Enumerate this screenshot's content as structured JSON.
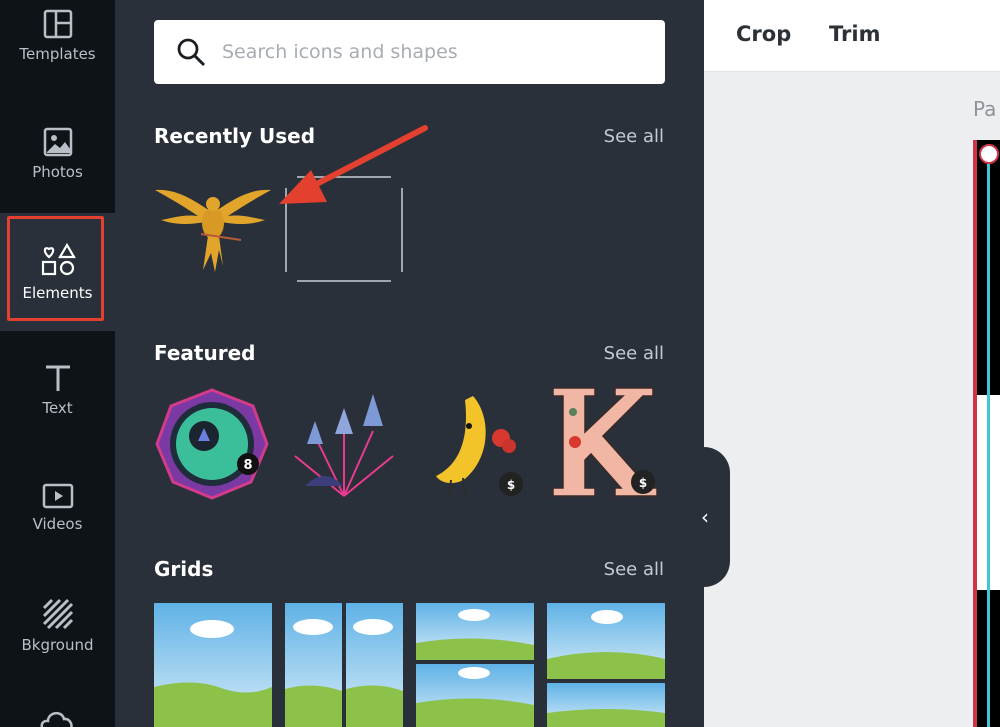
{
  "sidebar": {
    "items": [
      {
        "label": "Templates",
        "icon": "templates-icon"
      },
      {
        "label": "Photos",
        "icon": "photo-icon"
      },
      {
        "label": "Elements",
        "icon": "elements-icon",
        "selected": true
      },
      {
        "label": "Text",
        "icon": "text-icon"
      },
      {
        "label": "Videos",
        "icon": "video-icon"
      },
      {
        "label": "Bkground",
        "icon": "background-icon"
      }
    ]
  },
  "search": {
    "placeholder": "Search icons and shapes"
  },
  "sections": {
    "recent": {
      "title": "Recently Used",
      "see_all": "See all"
    },
    "featured": {
      "title": "Featured",
      "see_all": "See all",
      "price_badge": "$"
    },
    "grids": {
      "title": "Grids",
      "see_all": "See all"
    }
  },
  "toolbar": {
    "crop": "Crop",
    "trim": "Trim"
  },
  "canvas": {
    "page_label": "Pa"
  },
  "collapse_glyph": "‹",
  "colors": {
    "accent_red": "#e4402f",
    "panel": "#293039",
    "rail": "#0e1318"
  }
}
